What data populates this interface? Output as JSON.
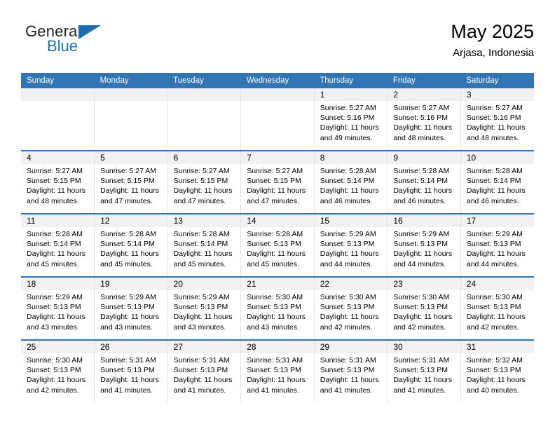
{
  "brand": {
    "name_part1": "General",
    "name_part2": "Blue",
    "flag_icon": "triangle-flag-icon"
  },
  "header": {
    "title": "May 2025",
    "subtitle": "Arjasa, Indonesia"
  },
  "colors": {
    "header_blue": "#3075b5",
    "brand_blue": "#1b75bb",
    "daynum_band": "#f1f1f1",
    "cell_border": "#e4e4e4"
  },
  "calendar": {
    "weekday_headers": [
      "Sunday",
      "Monday",
      "Tuesday",
      "Wednesday",
      "Thursday",
      "Friday",
      "Saturday"
    ],
    "weeks": [
      [
        {
          "day": "",
          "empty": true,
          "sunrise": "",
          "sunset": "",
          "daylight1": "",
          "daylight2": ""
        },
        {
          "day": "",
          "empty": true,
          "sunrise": "",
          "sunset": "",
          "daylight1": "",
          "daylight2": ""
        },
        {
          "day": "",
          "empty": true,
          "sunrise": "",
          "sunset": "",
          "daylight1": "",
          "daylight2": ""
        },
        {
          "day": "",
          "empty": true,
          "sunrise": "",
          "sunset": "",
          "daylight1": "",
          "daylight2": ""
        },
        {
          "day": "1",
          "empty": false,
          "sunrise": "Sunrise: 5:27 AM",
          "sunset": "Sunset: 5:16 PM",
          "daylight1": "Daylight: 11 hours",
          "daylight2": "and 49 minutes."
        },
        {
          "day": "2",
          "empty": false,
          "sunrise": "Sunrise: 5:27 AM",
          "sunset": "Sunset: 5:16 PM",
          "daylight1": "Daylight: 11 hours",
          "daylight2": "and 48 minutes."
        },
        {
          "day": "3",
          "empty": false,
          "sunrise": "Sunrise: 5:27 AM",
          "sunset": "Sunset: 5:16 PM",
          "daylight1": "Daylight: 11 hours",
          "daylight2": "and 48 minutes."
        }
      ],
      [
        {
          "day": "4",
          "empty": false,
          "sunrise": "Sunrise: 5:27 AM",
          "sunset": "Sunset: 5:15 PM",
          "daylight1": "Daylight: 11 hours",
          "daylight2": "and 48 minutes."
        },
        {
          "day": "5",
          "empty": false,
          "sunrise": "Sunrise: 5:27 AM",
          "sunset": "Sunset: 5:15 PM",
          "daylight1": "Daylight: 11 hours",
          "daylight2": "and 47 minutes."
        },
        {
          "day": "6",
          "empty": false,
          "sunrise": "Sunrise: 5:27 AM",
          "sunset": "Sunset: 5:15 PM",
          "daylight1": "Daylight: 11 hours",
          "daylight2": "and 47 minutes."
        },
        {
          "day": "7",
          "empty": false,
          "sunrise": "Sunrise: 5:27 AM",
          "sunset": "Sunset: 5:15 PM",
          "daylight1": "Daylight: 11 hours",
          "daylight2": "and 47 minutes."
        },
        {
          "day": "8",
          "empty": false,
          "sunrise": "Sunrise: 5:28 AM",
          "sunset": "Sunset: 5:14 PM",
          "daylight1": "Daylight: 11 hours",
          "daylight2": "and 46 minutes."
        },
        {
          "day": "9",
          "empty": false,
          "sunrise": "Sunrise: 5:28 AM",
          "sunset": "Sunset: 5:14 PM",
          "daylight1": "Daylight: 11 hours",
          "daylight2": "and 46 minutes."
        },
        {
          "day": "10",
          "empty": false,
          "sunrise": "Sunrise: 5:28 AM",
          "sunset": "Sunset: 5:14 PM",
          "daylight1": "Daylight: 11 hours",
          "daylight2": "and 46 minutes."
        }
      ],
      [
        {
          "day": "11",
          "empty": false,
          "sunrise": "Sunrise: 5:28 AM",
          "sunset": "Sunset: 5:14 PM",
          "daylight1": "Daylight: 11 hours",
          "daylight2": "and 45 minutes."
        },
        {
          "day": "12",
          "empty": false,
          "sunrise": "Sunrise: 5:28 AM",
          "sunset": "Sunset: 5:14 PM",
          "daylight1": "Daylight: 11 hours",
          "daylight2": "and 45 minutes."
        },
        {
          "day": "13",
          "empty": false,
          "sunrise": "Sunrise: 5:28 AM",
          "sunset": "Sunset: 5:14 PM",
          "daylight1": "Daylight: 11 hours",
          "daylight2": "and 45 minutes."
        },
        {
          "day": "14",
          "empty": false,
          "sunrise": "Sunrise: 5:28 AM",
          "sunset": "Sunset: 5:13 PM",
          "daylight1": "Daylight: 11 hours",
          "daylight2": "and 45 minutes."
        },
        {
          "day": "15",
          "empty": false,
          "sunrise": "Sunrise: 5:29 AM",
          "sunset": "Sunset: 5:13 PM",
          "daylight1": "Daylight: 11 hours",
          "daylight2": "and 44 minutes."
        },
        {
          "day": "16",
          "empty": false,
          "sunrise": "Sunrise: 5:29 AM",
          "sunset": "Sunset: 5:13 PM",
          "daylight1": "Daylight: 11 hours",
          "daylight2": "and 44 minutes."
        },
        {
          "day": "17",
          "empty": false,
          "sunrise": "Sunrise: 5:29 AM",
          "sunset": "Sunset: 5:13 PM",
          "daylight1": "Daylight: 11 hours",
          "daylight2": "and 44 minutes."
        }
      ],
      [
        {
          "day": "18",
          "empty": false,
          "sunrise": "Sunrise: 5:29 AM",
          "sunset": "Sunset: 5:13 PM",
          "daylight1": "Daylight: 11 hours",
          "daylight2": "and 43 minutes."
        },
        {
          "day": "19",
          "empty": false,
          "sunrise": "Sunrise: 5:29 AM",
          "sunset": "Sunset: 5:13 PM",
          "daylight1": "Daylight: 11 hours",
          "daylight2": "and 43 minutes."
        },
        {
          "day": "20",
          "empty": false,
          "sunrise": "Sunrise: 5:29 AM",
          "sunset": "Sunset: 5:13 PM",
          "daylight1": "Daylight: 11 hours",
          "daylight2": "and 43 minutes."
        },
        {
          "day": "21",
          "empty": false,
          "sunrise": "Sunrise: 5:30 AM",
          "sunset": "Sunset: 5:13 PM",
          "daylight1": "Daylight: 11 hours",
          "daylight2": "and 43 minutes."
        },
        {
          "day": "22",
          "empty": false,
          "sunrise": "Sunrise: 5:30 AM",
          "sunset": "Sunset: 5:13 PM",
          "daylight1": "Daylight: 11 hours",
          "daylight2": "and 42 minutes."
        },
        {
          "day": "23",
          "empty": false,
          "sunrise": "Sunrise: 5:30 AM",
          "sunset": "Sunset: 5:13 PM",
          "daylight1": "Daylight: 11 hours",
          "daylight2": "and 42 minutes."
        },
        {
          "day": "24",
          "empty": false,
          "sunrise": "Sunrise: 5:30 AM",
          "sunset": "Sunset: 5:13 PM",
          "daylight1": "Daylight: 11 hours",
          "daylight2": "and 42 minutes."
        }
      ],
      [
        {
          "day": "25",
          "empty": false,
          "sunrise": "Sunrise: 5:30 AM",
          "sunset": "Sunset: 5:13 PM",
          "daylight1": "Daylight: 11 hours",
          "daylight2": "and 42 minutes."
        },
        {
          "day": "26",
          "empty": false,
          "sunrise": "Sunrise: 5:31 AM",
          "sunset": "Sunset: 5:13 PM",
          "daylight1": "Daylight: 11 hours",
          "daylight2": "and 41 minutes."
        },
        {
          "day": "27",
          "empty": false,
          "sunrise": "Sunrise: 5:31 AM",
          "sunset": "Sunset: 5:13 PM",
          "daylight1": "Daylight: 11 hours",
          "daylight2": "and 41 minutes."
        },
        {
          "day": "28",
          "empty": false,
          "sunrise": "Sunrise: 5:31 AM",
          "sunset": "Sunset: 5:13 PM",
          "daylight1": "Daylight: 11 hours",
          "daylight2": "and 41 minutes."
        },
        {
          "day": "29",
          "empty": false,
          "sunrise": "Sunrise: 5:31 AM",
          "sunset": "Sunset: 5:13 PM",
          "daylight1": "Daylight: 11 hours",
          "daylight2": "and 41 minutes."
        },
        {
          "day": "30",
          "empty": false,
          "sunrise": "Sunrise: 5:31 AM",
          "sunset": "Sunset: 5:13 PM",
          "daylight1": "Daylight: 11 hours",
          "daylight2": "and 41 minutes."
        },
        {
          "day": "31",
          "empty": false,
          "sunrise": "Sunrise: 5:32 AM",
          "sunset": "Sunset: 5:13 PM",
          "daylight1": "Daylight: 11 hours",
          "daylight2": "and 40 minutes."
        }
      ]
    ]
  }
}
